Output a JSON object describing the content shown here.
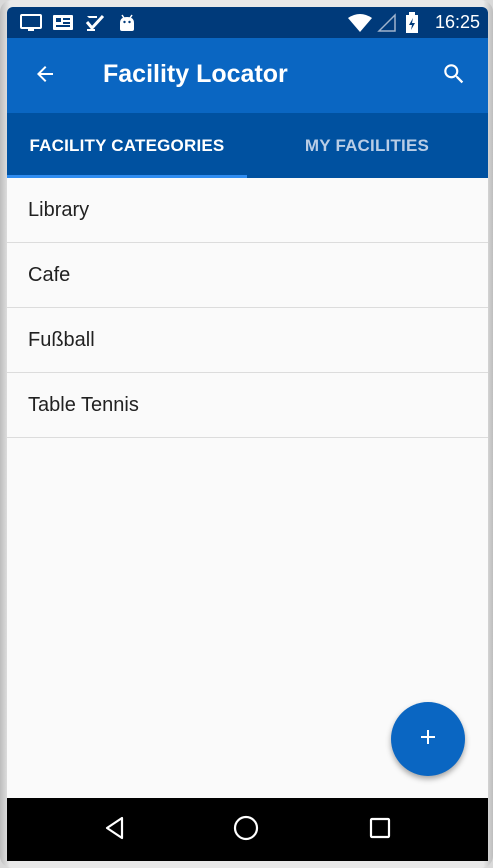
{
  "status_bar": {
    "time": "16:25",
    "icons": [
      "screen-cast-icon",
      "news-icon",
      "tasks-icon",
      "android-icon",
      "wifi-icon",
      "signal-icon",
      "battery-charging-icon"
    ]
  },
  "app_bar": {
    "title": "Facility Locator",
    "back_icon": "arrow-back-icon",
    "search_icon": "search-icon"
  },
  "tabs": [
    {
      "label": "FACILITY CATEGORIES",
      "active": true
    },
    {
      "label": "MY FACILITIES",
      "active": false
    }
  ],
  "list": {
    "items": [
      {
        "label": "Library"
      },
      {
        "label": "Cafe"
      },
      {
        "label": "Fußball"
      },
      {
        "label": "Table Tennis"
      }
    ]
  },
  "fab": {
    "icon": "add-icon"
  },
  "nav_bar": {
    "icons": [
      "back-triangle-icon",
      "home-circle-icon",
      "recents-square-icon"
    ]
  },
  "colors": {
    "status_bar": "#003a7a",
    "app_bar": "#0a66c2",
    "tab_bar": "#0051a0",
    "tab_indicator": "#2f8cf0",
    "fab": "#0a66c2"
  }
}
